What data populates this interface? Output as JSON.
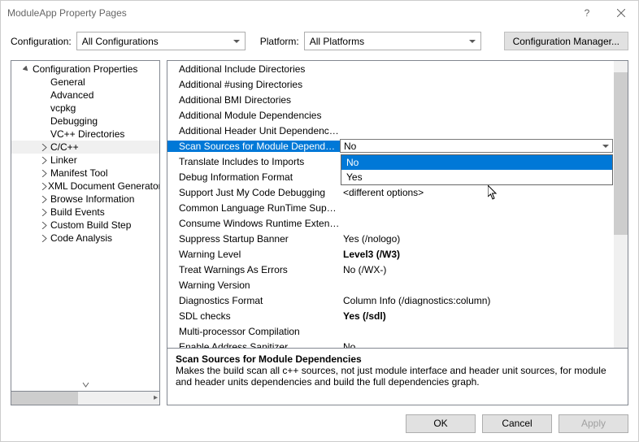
{
  "window": {
    "title": "ModuleApp Property Pages"
  },
  "toolbar": {
    "config_label": "Configuration:",
    "config_value": "All Configurations",
    "platform_label": "Platform:",
    "platform_value": "All Platforms",
    "cfg_manager": "Configuration Manager..."
  },
  "tree": {
    "root": "Configuration Properties",
    "items": [
      {
        "label": "General"
      },
      {
        "label": "Advanced"
      },
      {
        "label": "vcpkg"
      },
      {
        "label": "Debugging"
      },
      {
        "label": "VC++ Directories"
      },
      {
        "label": "C/C++",
        "expandable": true,
        "selected": true
      },
      {
        "label": "Linker",
        "expandable": true
      },
      {
        "label": "Manifest Tool",
        "expandable": true
      },
      {
        "label": "XML Document Generator",
        "expandable": true
      },
      {
        "label": "Browse Information",
        "expandable": true
      },
      {
        "label": "Build Events",
        "expandable": true
      },
      {
        "label": "Custom Build Step",
        "expandable": true
      },
      {
        "label": "Code Analysis",
        "expandable": true
      }
    ]
  },
  "grid": {
    "rows": [
      {
        "name": "Additional Include Directories",
        "value": ""
      },
      {
        "name": "Additional #using Directories",
        "value": ""
      },
      {
        "name": "Additional BMI Directories",
        "value": ""
      },
      {
        "name": "Additional Module Dependencies",
        "value": ""
      },
      {
        "name": "Additional Header Unit Dependencies",
        "value": ""
      },
      {
        "name": "Scan Sources for Module Dependencies",
        "value": "No",
        "selected": true
      },
      {
        "name": "Translate Includes to Imports",
        "value": ""
      },
      {
        "name": "Debug Information Format",
        "value": ""
      },
      {
        "name": "Support Just My Code Debugging",
        "value": "<different options>"
      },
      {
        "name": "Common Language RunTime Support",
        "value": ""
      },
      {
        "name": "Consume Windows Runtime Extension",
        "value": ""
      },
      {
        "name": "Suppress Startup Banner",
        "value": "Yes (/nologo)"
      },
      {
        "name": "Warning Level",
        "value": "Level3 (/W3)",
        "bold": true
      },
      {
        "name": "Treat Warnings As Errors",
        "value": "No (/WX-)"
      },
      {
        "name": "Warning Version",
        "value": ""
      },
      {
        "name": "Diagnostics Format",
        "value": "Column Info (/diagnostics:column)"
      },
      {
        "name": "SDL checks",
        "value": "Yes (/sdl)",
        "bold": true
      },
      {
        "name": "Multi-processor Compilation",
        "value": ""
      },
      {
        "name": "Enable Address Sanitizer",
        "value": "No"
      }
    ]
  },
  "dropdown": {
    "options": [
      "No",
      "Yes"
    ],
    "selectedIndex": 0
  },
  "description": {
    "title": "Scan Sources for Module Dependencies",
    "body": "Makes the build scan all c++ sources, not just module interface and header unit sources, for module and header units dependencies and build the full dependencies graph."
  },
  "footer": {
    "ok": "OK",
    "cancel": "Cancel",
    "apply": "Apply"
  }
}
